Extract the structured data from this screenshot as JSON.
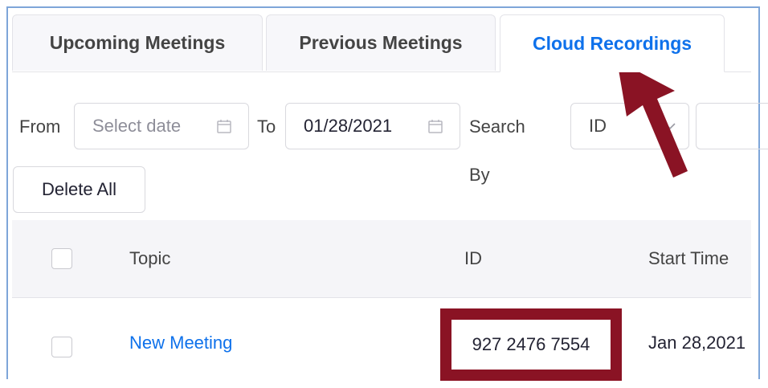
{
  "tabs": [
    {
      "label": "Upcoming Meetings",
      "active": false
    },
    {
      "label": "Previous Meetings",
      "active": false
    },
    {
      "label": "Cloud Recordings",
      "active": true
    }
  ],
  "filters": {
    "from_label": "From",
    "from_placeholder": "Select date",
    "to_label": "To",
    "to_value": "01/28/2021",
    "search_by_label": "Search By",
    "search_by_value": "ID"
  },
  "actions": {
    "delete_all_label": "Delete All"
  },
  "table": {
    "columns": [
      "Topic",
      "ID",
      "Start Time"
    ],
    "rows": [
      {
        "topic": "New Meeting",
        "id": "927 2476 7554",
        "start_time": "Jan 28,2021"
      }
    ]
  },
  "colors": {
    "accent": "#0e71eb",
    "annotation": "#8a1324"
  }
}
